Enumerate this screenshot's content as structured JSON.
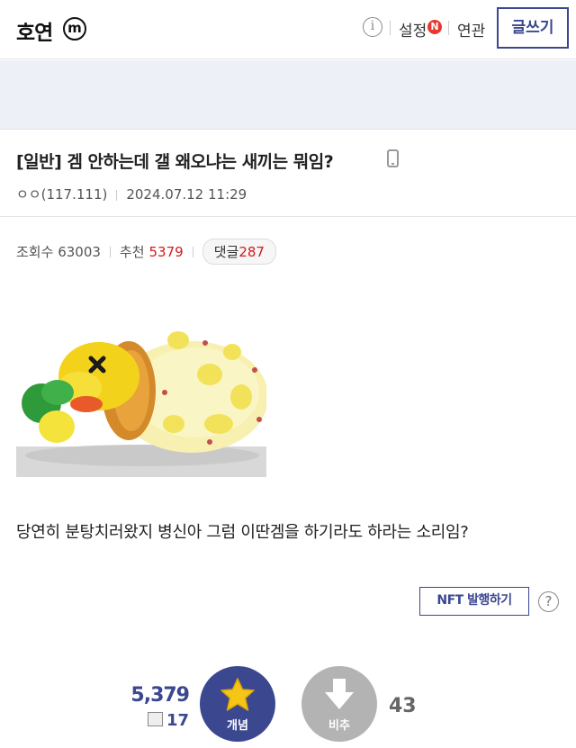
{
  "header": {
    "logo": "호연",
    "logo_badge": "m",
    "settings_label": "설정",
    "new_badge": "N",
    "related_label": "연관",
    "write_label": "글쓰기"
  },
  "post": {
    "title": "[일반] 겜 안하는데 갤 왜오냐는 새끼는 뭐임?",
    "author": "ㅇㅇ(117.111)",
    "date": "2024.07.12 11:29",
    "views_label": "조회수",
    "views": "63003",
    "recommend_label": "추천",
    "recommend": "5379",
    "comments_label": "댓글",
    "comments": "287",
    "body": "당연히 분탕치러왔지 병신아 그럼 이딴겜을 하기라도 하라는 소리임?",
    "nft_label": "NFT 발행하기",
    "help_icon": "?"
  },
  "vote": {
    "up_count": "5,379",
    "fix_count": "17",
    "up_label": "개념",
    "down_label": "비추",
    "down_count": "43"
  },
  "colors": {
    "brand": "#3b4890",
    "accent_red": "#d31a1a",
    "banner_bg": "#edf0f7"
  }
}
